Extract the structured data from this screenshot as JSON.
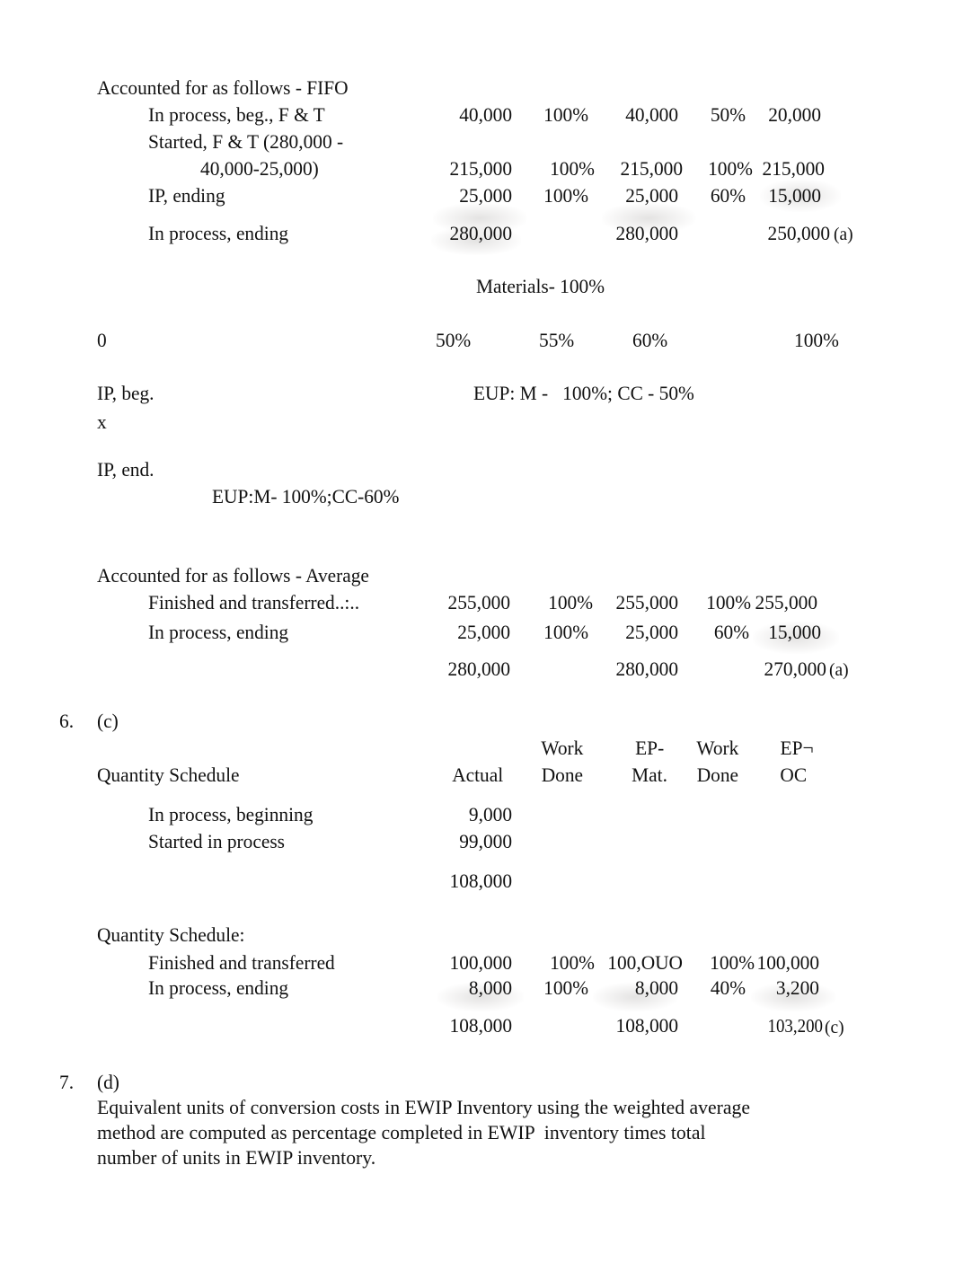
{
  "document": {
    "type": "accounting-worksheet",
    "subject": "Process costing - equivalent units of production"
  },
  "fifo_section": {
    "heading": "Accounted for as follows - FIFO",
    "rows": [
      {
        "label": "In process, beg., F & T",
        "actual": "40,000",
        "pct_mat": "100%",
        "ep_mat": "40,000",
        "pct_cc": "50%",
        "ep_cc": "20,000"
      },
      {
        "label_line1": "Started, F & T (280,000 -",
        "label_line2": "40,000-25,000)",
        "actual": "215,000",
        "pct_mat": "100%",
        "ep_mat": "215,000",
        "pct_cc": "100%",
        "ep_cc": "215,000"
      },
      {
        "label": "IP, ending",
        "actual": "25,000",
        "pct_mat": "100%",
        "ep_mat": "25,000",
        "pct_cc": "60%",
        "ep_cc": "15,000"
      }
    ],
    "total": {
      "label": "In process, ending",
      "actual": "280,000",
      "ep_mat": "280,000",
      "ep_cc": "250,000",
      "ep_cc_note": "(a)"
    }
  },
  "timeline": {
    "materials_note": "Materials- 100%",
    "scale": [
      {
        "label": "0"
      },
      {
        "label": "50%"
      },
      {
        "label": "55%"
      },
      {
        "label": "60%"
      },
      {
        "label": "100%"
      }
    ],
    "ip_beg_label": "IP, beg.",
    "x_marker": "x",
    "ip_beg_eup": "EUP: M -   100%; CC - 50%",
    "ip_end_label": "IP, end.",
    "ip_end_eup": "EUP:M- 100%;CC-60%"
  },
  "average_section": {
    "heading": "Accounted for as follows - Average",
    "rows": [
      {
        "label": "Finished and transferred..:..",
        "actual": "255,000",
        "pct_mat": "100%",
        "ep_mat": "255,000",
        "pct_cc": "100%",
        "ep_cc": "255,000"
      },
      {
        "label": "In process, ending",
        "actual": "25,000",
        "pct_mat": "100%",
        "ep_mat": "25,000",
        "pct_cc": "60%",
        "ep_cc": "15,000"
      }
    ],
    "total": {
      "actual": "280,000",
      "ep_mat": "280,000",
      "ep_cc": "270,000",
      "ep_cc_note": "(a)"
    }
  },
  "item6": {
    "number": "6.",
    "answer": "(c)",
    "headers": {
      "actual": "Actual",
      "work_done_1_line1": "Work",
      "work_done_1_line2": "Done",
      "ep_mat_line1": "EP-",
      "ep_mat_line2": "Mat.",
      "work_done_2_line1": "Work",
      "work_done_2_line2": "Done",
      "ep_oc_line1": "EP¬",
      "ep_oc_line2": "OC"
    },
    "schedule_title": "Quantity Schedule",
    "rows": [
      {
        "label": "In process, beginning",
        "actual": "9,000"
      },
      {
        "label": "Started in process",
        "actual": "99,000"
      }
    ],
    "subtotal": "108,000",
    "schedule2_title": "Quantity Schedule:",
    "rows2": [
      {
        "label": "Finished and transferred",
        "actual": "100,000",
        "pct_mat": "100%",
        "ep_mat": "100,OUO",
        "pct_cc": "100%",
        "ep_cc": "100,000"
      },
      {
        "label": "In process, ending",
        "actual": "8,000",
        "pct_mat": "100%",
        "ep_mat": "8,000",
        "pct_cc": "40%",
        "ep_cc": "3,200"
      }
    ],
    "total": {
      "actual": "108,000",
      "ep_mat": "108,000",
      "ep_cc": "103,200",
      "ep_cc_note": "(c)"
    }
  },
  "item7": {
    "number": "7.",
    "answer": "(d)",
    "paragraph_line1": "Equivalent units of conversion costs in EWIP Inventory using the weighted average",
    "paragraph_line2": "method are computed as percentage completed in EWIP  inventory times total",
    "paragraph_line3": "number of units in EWIP inventory."
  }
}
